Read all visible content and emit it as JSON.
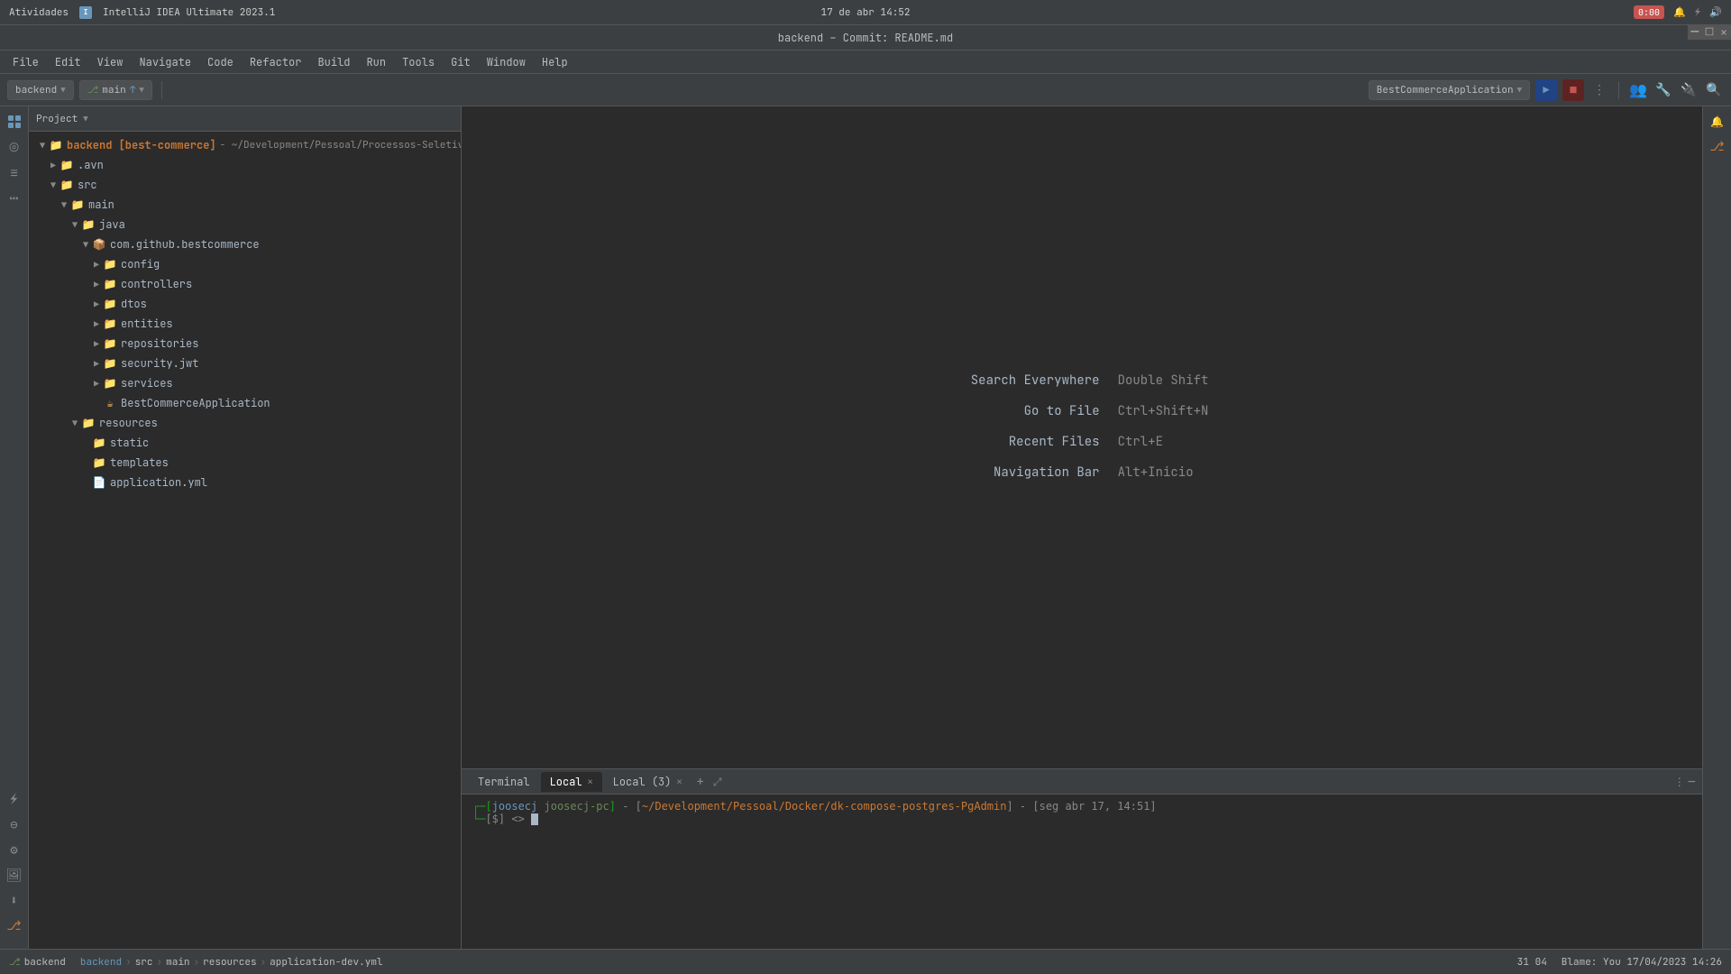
{
  "os_bar": {
    "activities": "Atividades",
    "app_name": "IntelliJ IDEA Ultimate 2023.1",
    "datetime": "17 de abr  14:52",
    "timer": "0:00",
    "window_controls": [
      "_",
      "□",
      "✕"
    ]
  },
  "title_bar": {
    "title": "backend – Commit: README.md"
  },
  "menu": {
    "items": [
      "File",
      "Edit",
      "View",
      "Navigate",
      "Code",
      "Refactor",
      "Build",
      "Run",
      "Tools",
      "Git",
      "Window",
      "Help"
    ]
  },
  "toolbar": {
    "project_label": "backend",
    "branch_label": "main",
    "app_config_label": "BestCommerceApplication",
    "run_label": "▶",
    "stop_label": "■"
  },
  "project_panel": {
    "title": "Project",
    "tree": [
      {
        "id": "backend",
        "label": "backend [best-commerce]",
        "path": " - ~/Development/Pessoal/Processos-Seletivos",
        "indent": 0,
        "type": "root",
        "open": true
      },
      {
        "id": "avn",
        "label": ".avn",
        "indent": 1,
        "type": "folder",
        "open": false
      },
      {
        "id": "src",
        "label": "src",
        "indent": 1,
        "type": "folder",
        "open": true
      },
      {
        "id": "main",
        "label": "main",
        "indent": 2,
        "type": "folder",
        "open": true
      },
      {
        "id": "java",
        "label": "java",
        "indent": 3,
        "type": "java-folder",
        "open": true
      },
      {
        "id": "bestcommerce",
        "label": "com.github.bestcommerce",
        "indent": 4,
        "type": "package",
        "open": true
      },
      {
        "id": "config",
        "label": "config",
        "indent": 5,
        "type": "folder-purple",
        "open": false
      },
      {
        "id": "controllers",
        "label": "controllers",
        "indent": 5,
        "type": "folder-pink",
        "open": false
      },
      {
        "id": "dtos",
        "label": "dtos",
        "indent": 5,
        "type": "folder-orange",
        "open": false
      },
      {
        "id": "entities",
        "label": "entities",
        "indent": 5,
        "type": "folder-purple",
        "open": false
      },
      {
        "id": "repositories",
        "label": "repositories",
        "indent": 5,
        "type": "folder-purple",
        "open": false
      },
      {
        "id": "security_jwt",
        "label": "security.jwt",
        "indent": 5,
        "type": "folder-pink",
        "open": false
      },
      {
        "id": "services",
        "label": "services",
        "indent": 5,
        "type": "folder-purple",
        "open": false
      },
      {
        "id": "bestcommerceapp",
        "label": "BestCommerceApplication",
        "indent": 5,
        "type": "java-file"
      },
      {
        "id": "resources",
        "label": "resources",
        "indent": 3,
        "type": "folder",
        "open": true
      },
      {
        "id": "static",
        "label": "static",
        "indent": 4,
        "type": "folder-yellow"
      },
      {
        "id": "templates",
        "label": "templates",
        "indent": 4,
        "type": "folder-yellow"
      },
      {
        "id": "application_yml",
        "label": "application.yml",
        "indent": 4,
        "type": "yaml-file"
      }
    ]
  },
  "shortcuts": [
    {
      "label": "Search Everywhere",
      "key": "Double Shift"
    },
    {
      "label": "Go to File",
      "key": "Ctrl+Shift+N"
    },
    {
      "label": "Recent Files",
      "key": "Ctrl+E"
    },
    {
      "label": "Navigation Bar",
      "key": "Alt+Inicio"
    }
  ],
  "terminal": {
    "tabs": [
      {
        "label": "Terminal",
        "active": false
      },
      {
        "label": "Local",
        "active": true,
        "closeable": true
      },
      {
        "label": "Local (3)",
        "active": false,
        "closeable": true
      }
    ],
    "lines": [
      {
        "user": "joosecj",
        "host": "joosecj-pc",
        "path": "~/Development/Pessoal/Docker/dk-compose-postgres-PgAdmin",
        "suffix": " - [seg abr 17, 14:51]"
      },
      {
        "prompt": "[$] <>",
        "cursor": true
      }
    ]
  },
  "status_bar": {
    "git_icon": "⎇",
    "branch": "backend",
    "breadcrumbs": [
      "backend",
      "src",
      "main",
      "resources",
      "application-dev.yml"
    ],
    "separators": [
      ">",
      ">",
      ">",
      ">"
    ],
    "line_col": "31 04",
    "blame": "Blame: You  17/04/2023 14:26"
  }
}
